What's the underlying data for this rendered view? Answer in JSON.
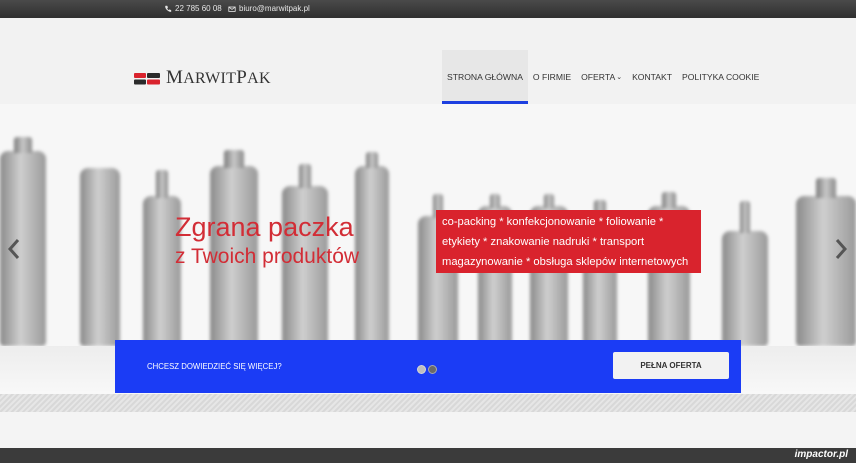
{
  "topbar": {
    "phone": "22 785 60 08",
    "email": "biuro@marwitpak.pl",
    "phone_icon": "phone-icon",
    "email_icon": "envelope-icon"
  },
  "logo": {
    "text_first": "M",
    "text_rest1": "ARWIT",
    "text_second": "P",
    "text_rest2": "AK"
  },
  "nav": {
    "items": [
      {
        "label": "Strona Główna",
        "active": true
      },
      {
        "label": "O Firmie"
      },
      {
        "label": "Oferta",
        "dropdown": true
      },
      {
        "label": "Kontakt"
      },
      {
        "label": "Polityka Cookie"
      }
    ]
  },
  "hero": {
    "headline_line1": "Zgrana paczka",
    "headline_line2": "z Twoich produktów",
    "services_line1": "co-packing * konfekcjonowanie * foliowanie *",
    "services_line2": "etykiety * znakowanie nadruki * transport",
    "services_line3": "magazynowanie * obsługa sklepów internetowych",
    "prev_icon": "chevron-left-icon",
    "next_icon": "chevron-right-icon"
  },
  "cta": {
    "text": "Chcesz dowiedzieć się więcej?",
    "button": "Pełna oferta",
    "slide_count": 2,
    "active_slide": 2
  },
  "footer": {
    "watermark": "impactor.pl"
  },
  "colors": {
    "accent_blue": "#1b3cf5",
    "accent_red": "#d9232d",
    "topbar": "#3a3a3a"
  }
}
